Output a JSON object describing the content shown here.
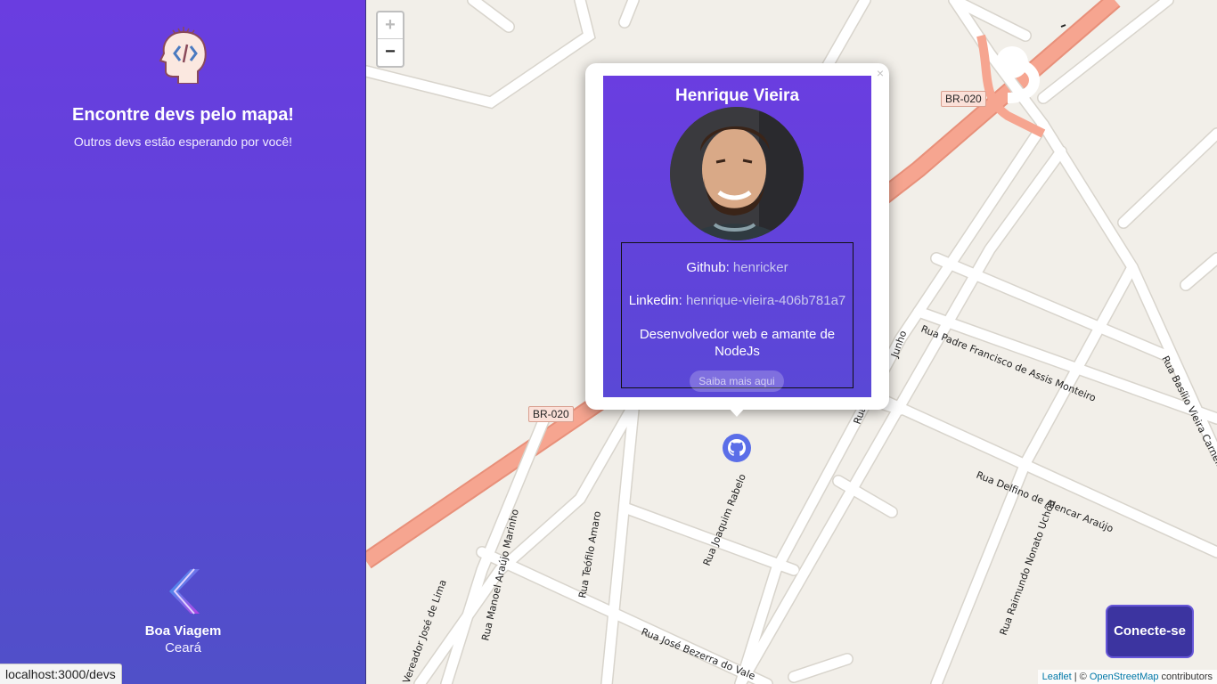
{
  "sidebar": {
    "title": "Encontre devs pelo mapa!",
    "subtitle": "Outros devs estão esperando por você!",
    "location_city": "Boa Viagem",
    "location_state": "Ceará",
    "logo_icon": "head-code-icon",
    "back_icon": "chevron-left-icon"
  },
  "status_bar": {
    "url": "localhost:3000/devs"
  },
  "map": {
    "zoom_in": "+",
    "zoom_out": "−",
    "highway_shields": [
      "BR-020",
      "BR-020"
    ],
    "streets": [
      "Rua Padre Francisco de Assis Monteiro",
      "Rua Basílio Vieira Carneiro",
      "Rua Delfino de Alencar Araújo",
      "Rua Raimundo Nonato Uchôa",
      "Rua Joaquim Rabelo",
      "Rua Teófilo Amaro",
      "Rua Manoel Araújo Marinho",
      "Vereador José de Lima",
      "Rua José Bezerra do Vale",
      "Junho",
      "Rua"
    ],
    "attribution": {
      "leaflet": "Leaflet",
      "separator": " | © ",
      "osm": "OpenStreetMap",
      "suffix": " contributors"
    }
  },
  "popup": {
    "close": "×",
    "name": "Henrique Vieira",
    "github_label": "Github:",
    "github_value": "henricker",
    "linkedin_label": "Linkedin:",
    "linkedin_value": "henrique-vieira-406b781a7",
    "bio": "Desenvolvedor web e amante de NodeJs",
    "more_button": "Saiba mais aqui"
  },
  "marker": {
    "icon": "github-icon"
  },
  "connect_button": "Conecte-se"
}
